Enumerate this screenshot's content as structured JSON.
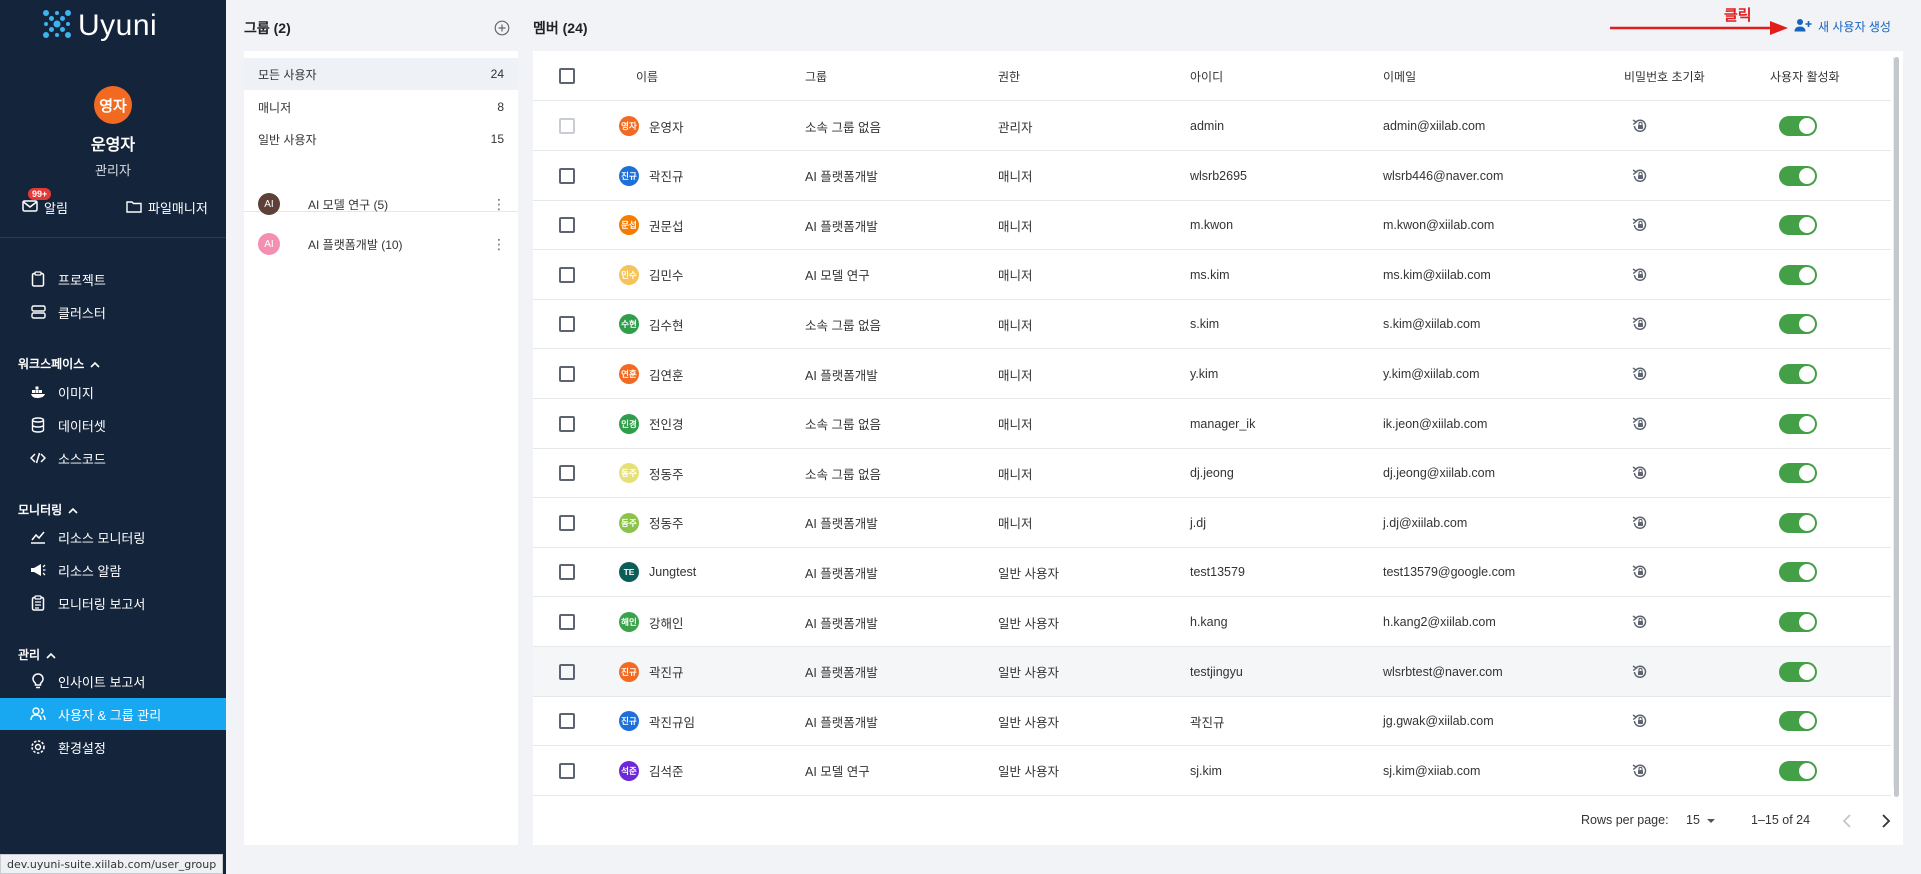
{
  "sidebar": {
    "brand": "Uyuni",
    "user": {
      "avatar_text": "영자",
      "name": "운영자",
      "role": "관리자"
    },
    "notifications": {
      "badge": "99+",
      "label": "알림"
    },
    "file_manager": "파일매니저",
    "items": [
      {
        "label": "프로젝트",
        "icon": "clipboard-icon"
      },
      {
        "label": "클러스터",
        "icon": "server-icon"
      }
    ],
    "sections": [
      {
        "title": "워크스페이스",
        "items": [
          {
            "label": "이미지",
            "icon": "docker-icon"
          },
          {
            "label": "데이터셋",
            "icon": "database-icon"
          },
          {
            "label": "소스코드",
            "icon": "code-icon"
          }
        ]
      },
      {
        "title": "모니터링",
        "items": [
          {
            "label": "리소스 모니터링",
            "icon": "chart-line-icon"
          },
          {
            "label": "리소스 알람",
            "icon": "megaphone-icon"
          },
          {
            "label": "모니터링 보고서",
            "icon": "report-icon"
          }
        ]
      },
      {
        "title": "관리",
        "items": [
          {
            "label": "인사이트 보고서",
            "icon": "lightbulb-icon"
          },
          {
            "label": "사용자 & 그룹 관리",
            "icon": "users-icon"
          },
          {
            "label": "환경설정",
            "icon": "gear-icon"
          }
        ]
      }
    ],
    "status_url": "dev.uyuni-suite.xiilab.com/user_group"
  },
  "groups": {
    "title": "그룹 (2)",
    "filters": [
      {
        "label": "모든 사용자",
        "count": "24"
      },
      {
        "label": "매니저",
        "count": "8"
      },
      {
        "label": "일반 사용자",
        "count": "15"
      }
    ],
    "items": [
      {
        "avatar": "AI",
        "label": "AI 모델 연구 (5)",
        "color": "#5d4037"
      },
      {
        "avatar": "AI",
        "label": "AI 플랫폼개발 (10)",
        "color": "#f48fb1"
      }
    ]
  },
  "members": {
    "title": "멤버 (24)",
    "annotation": "클릭",
    "new_user_label": "새 사용자 생성",
    "columns": [
      "이름",
      "그룹",
      "권한",
      "아이디",
      "이메일",
      "비밀번호 초기화",
      "사용자 활성화"
    ],
    "rows": [
      {
        "avatar": "영자",
        "color": "#f26a21",
        "name": "운영자",
        "group": "소속 그룹 없음",
        "role": "관리자",
        "id": "admin",
        "email": "admin@xiilab.com"
      },
      {
        "avatar": "진규",
        "color": "#1e6fd9",
        "name": "곽진규",
        "group": "AI 플랫폼개발",
        "role": "매니저",
        "id": "wlsrb2695",
        "email": "wlsrb446@naver.com"
      },
      {
        "avatar": "문섭",
        "color": "#f57c00",
        "name": "권문섭",
        "group": "AI 플랫폼개발",
        "role": "매니저",
        "id": "m.kwon",
        "email": "m.kwon@xiilab.com"
      },
      {
        "avatar": "민수",
        "color": "#f6c35a",
        "name": "김민수",
        "group": "AI 모델 연구",
        "role": "매니저",
        "id": "ms.kim",
        "email": "ms.kim@xiilab.com"
      },
      {
        "avatar": "수현",
        "color": "#2e9e4a",
        "name": "김수현",
        "group": "소속 그룹 없음",
        "role": "매니저",
        "id": "s.kim",
        "email": "s.kim@xiilab.com"
      },
      {
        "avatar": "연훈",
        "color": "#f26a21",
        "name": "김연훈",
        "group": "AI 플랫폼개발",
        "role": "매니저",
        "id": "y.kim",
        "email": "y.kim@xiilab.com"
      },
      {
        "avatar": "인경",
        "color": "#2e9e4a",
        "name": "전인경",
        "group": "소속 그룹 없음",
        "role": "매니저",
        "id": "manager_ik",
        "email": "ik.jeon@xiilab.com"
      },
      {
        "avatar": "동주",
        "color": "#e6e07a",
        "name": "정동주",
        "group": "소속 그룹 없음",
        "role": "매니저",
        "id": "dj.jeong",
        "email": "dj.jeong@xiilab.com"
      },
      {
        "avatar": "동주",
        "color": "#8bc34a",
        "name": "정동주",
        "group": "AI 플랫폼개발",
        "role": "매니저",
        "id": "j.dj",
        "email": "j.dj@xiilab.com"
      },
      {
        "avatar": "TE",
        "color": "#0b5e57",
        "name": "Jungtest",
        "group": "AI 플랫폼개발",
        "role": "일반 사용자",
        "id": "test13579",
        "email": "test13579@google.com"
      },
      {
        "avatar": "해인",
        "color": "#3aa24a",
        "name": "강해인",
        "group": "AI 플랫폼개발",
        "role": "일반 사용자",
        "id": "h.kang",
        "email": "h.kang2@xiilab.com"
      },
      {
        "avatar": "진규",
        "color": "#f26a21",
        "name": "곽진규",
        "group": "AI 플랫폼개발",
        "role": "일반 사용자",
        "id": "testjingyu",
        "email": "wlsrbtest@naver.com"
      },
      {
        "avatar": "진규",
        "color": "#1e6fd9",
        "name": "곽진규임",
        "group": "AI 플랫폼개발",
        "role": "일반 사용자",
        "id": "곽진규",
        "email": "jg.gwak@xiilab.com"
      },
      {
        "avatar": "석준",
        "color": "#6d28d9",
        "name": "김석준",
        "group": "AI 모델 연구",
        "role": "일반 사용자",
        "id": "sj.kim",
        "email": "sj.kim@xiiab.com"
      }
    ],
    "pagination": {
      "rows_label": "Rows per page:",
      "rows_value": "15",
      "range": "1–15 of 24"
    }
  },
  "colors": {
    "sidebar_bg": "#14253b",
    "active_nav": "#18a7f1",
    "toggle_on": "#43a047",
    "link": "#1565c0",
    "annotation": "#e21b1b"
  }
}
